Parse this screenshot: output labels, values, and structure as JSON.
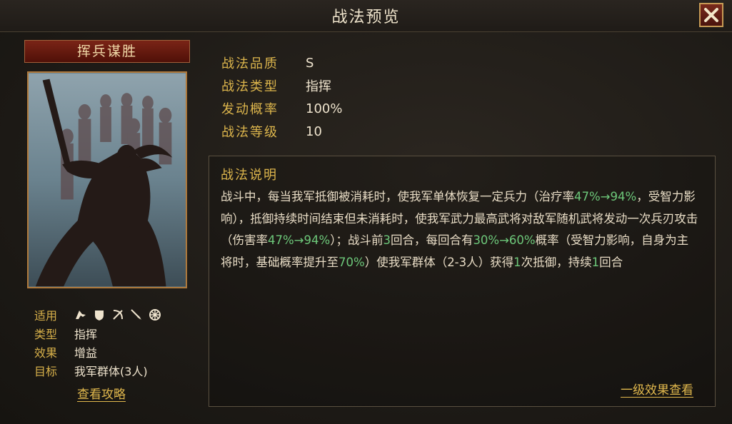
{
  "window": {
    "title": "战法预览"
  },
  "skill": {
    "name": "挥兵谋胜",
    "quality_label": "战法品质",
    "quality": "S",
    "type_label": "战法类型",
    "type": "指挥",
    "chance_label": "发动概率",
    "chance": "100%",
    "level_label": "战法等级",
    "level": "10"
  },
  "meta": {
    "applicable_label": "适用",
    "type_label": "类型",
    "type": "指挥",
    "effect_label": "效果",
    "effect": "增益",
    "target_label": "目标",
    "target": "我军群体(3人)",
    "troop_icons": [
      "cavalry-icon",
      "shield-icon",
      "bow-icon",
      "spear-icon",
      "wheel-icon"
    ]
  },
  "description": {
    "title": "战法说明",
    "segments": [
      {
        "t": "战斗中，每当我军抵御被消耗时，使我军单体恢复一定兵力（治疗率"
      },
      {
        "t": "47%→94%",
        "hl": true
      },
      {
        "t": "，受智力影响），抵御持续时间结束但未消耗时，使我军武力最高武将对敌军随机武将发动一次兵刃攻击（伤害率"
      },
      {
        "t": "47%→94%",
        "hl": true
      },
      {
        "t": "）；战斗前"
      },
      {
        "t": "3",
        "hl": true
      },
      {
        "t": "回合，每回合有"
      },
      {
        "t": "30%→60%",
        "hl": true
      },
      {
        "t": "概率（受智力影响，自身为主将时，基础概率提升至"
      },
      {
        "t": "70%",
        "hl": true
      },
      {
        "t": "）使我军群体（2-3人）获得"
      },
      {
        "t": "1",
        "hl": true
      },
      {
        "t": "次抵御，持续"
      },
      {
        "t": "1",
        "hl": true
      },
      {
        "t": "回合"
      }
    ]
  },
  "links": {
    "guide": "查看攻略",
    "level1_effect": "一级效果查看"
  },
  "colors": {
    "gold": "#dcb54c",
    "highlight": "#6dc87a",
    "red": "#7a2416"
  }
}
